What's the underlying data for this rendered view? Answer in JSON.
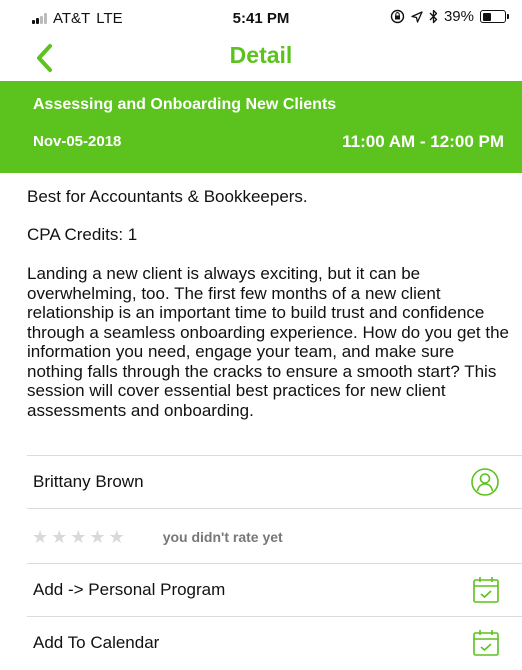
{
  "status_bar": {
    "carrier": "AT&T",
    "network": "LTE",
    "time": "5:41 PM",
    "battery": "39%",
    "battery_level": 0.39
  },
  "nav": {
    "title": "Detail"
  },
  "event": {
    "title": "Assessing and Onboarding New Clients",
    "date": "Nov-05-2018",
    "time": "11:00 AM - 12:00 PM"
  },
  "content": {
    "audience": "Best for Accountants & Bookkeepers.",
    "credits": "CPA Credits: 1",
    "description": "Landing a new client is always exciting, but it can be overwhelming, too. The first few months of a new client relationship is an important time to build trust and confidence through a seamless onboarding experience. How do you get the information you need, engage your team, and make sure nothing falls through the cracks to ensure a smooth start? This session will cover essential best practices for new client assessments and onboarding."
  },
  "speaker": {
    "name": "Brittany Brown"
  },
  "rating": {
    "stars": 0,
    "max_stars": 5,
    "text": "you didn't rate yet"
  },
  "actions": {
    "personal_program": "Add -> Personal Program",
    "calendar": "Add To Calendar"
  },
  "colors": {
    "accent": "#5cc21d",
    "star_empty": "#d9d9d9"
  }
}
